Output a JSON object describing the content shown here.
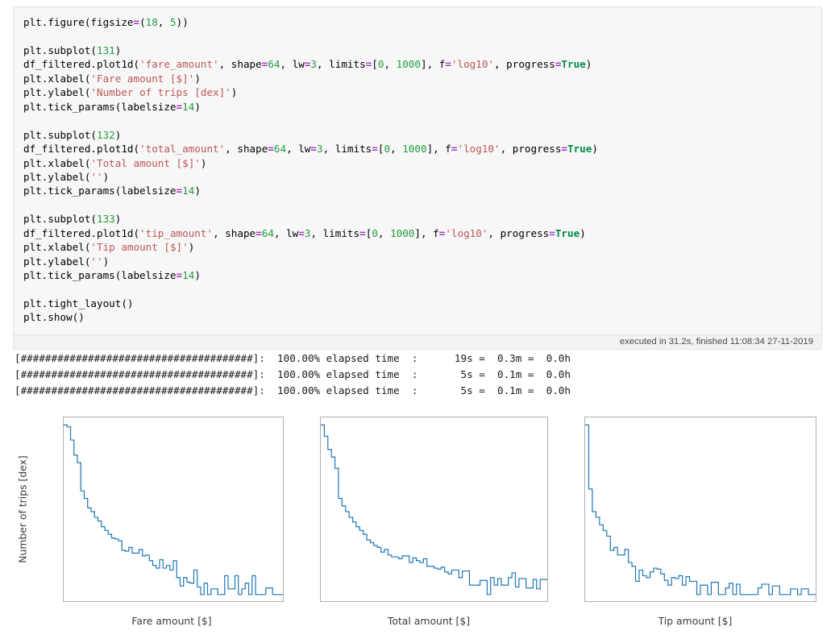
{
  "notebook": {
    "code_lines": [
      [
        {
          "t": "plt.figure(figsize",
          "c": "plain"
        },
        {
          "t": "=",
          "c": "op"
        },
        {
          "t": "(",
          "c": "plain"
        },
        {
          "t": "18",
          "c": "num"
        },
        {
          "t": ", ",
          "c": "plain"
        },
        {
          "t": "5",
          "c": "num"
        },
        {
          "t": "))",
          "c": "plain"
        }
      ],
      [],
      [
        {
          "t": "plt.subplot(",
          "c": "plain"
        },
        {
          "t": "131",
          "c": "num"
        },
        {
          "t": ")",
          "c": "plain"
        }
      ],
      [
        {
          "t": "df_filtered.plot1d(",
          "c": "plain"
        },
        {
          "t": "'fare_amount'",
          "c": "str"
        },
        {
          "t": ", shape",
          "c": "plain"
        },
        {
          "t": "=",
          "c": "op"
        },
        {
          "t": "64",
          "c": "num"
        },
        {
          "t": ", lw",
          "c": "plain"
        },
        {
          "t": "=",
          "c": "op"
        },
        {
          "t": "3",
          "c": "num"
        },
        {
          "t": ", limits",
          "c": "plain"
        },
        {
          "t": "=",
          "c": "op"
        },
        {
          "t": "[",
          "c": "plain"
        },
        {
          "t": "0",
          "c": "num"
        },
        {
          "t": ", ",
          "c": "plain"
        },
        {
          "t": "1000",
          "c": "num"
        },
        {
          "t": "], f",
          "c": "plain"
        },
        {
          "t": "=",
          "c": "op"
        },
        {
          "t": "'log10'",
          "c": "str"
        },
        {
          "t": ", progress",
          "c": "plain"
        },
        {
          "t": "=",
          "c": "op"
        },
        {
          "t": "True",
          "c": "kw"
        },
        {
          "t": ")",
          "c": "plain"
        }
      ],
      [
        {
          "t": "plt.xlabel(",
          "c": "plain"
        },
        {
          "t": "'Fare amount [$]'",
          "c": "str"
        },
        {
          "t": ")",
          "c": "plain"
        }
      ],
      [
        {
          "t": "plt.ylabel(",
          "c": "plain"
        },
        {
          "t": "'Number of trips [dex]'",
          "c": "str"
        },
        {
          "t": ")",
          "c": "plain"
        }
      ],
      [
        {
          "t": "plt.tick_params(labelsize",
          "c": "plain"
        },
        {
          "t": "=",
          "c": "op"
        },
        {
          "t": "14",
          "c": "num"
        },
        {
          "t": ")",
          "c": "plain"
        }
      ],
      [],
      [
        {
          "t": "plt.subplot(",
          "c": "plain"
        },
        {
          "t": "132",
          "c": "num"
        },
        {
          "t": ")",
          "c": "plain"
        }
      ],
      [
        {
          "t": "df_filtered.plot1d(",
          "c": "plain"
        },
        {
          "t": "'total_amount'",
          "c": "str"
        },
        {
          "t": ", shape",
          "c": "plain"
        },
        {
          "t": "=",
          "c": "op"
        },
        {
          "t": "64",
          "c": "num"
        },
        {
          "t": ", lw",
          "c": "plain"
        },
        {
          "t": "=",
          "c": "op"
        },
        {
          "t": "3",
          "c": "num"
        },
        {
          "t": ", limits",
          "c": "plain"
        },
        {
          "t": "=",
          "c": "op"
        },
        {
          "t": "[",
          "c": "plain"
        },
        {
          "t": "0",
          "c": "num"
        },
        {
          "t": ", ",
          "c": "plain"
        },
        {
          "t": "1000",
          "c": "num"
        },
        {
          "t": "], f",
          "c": "plain"
        },
        {
          "t": "=",
          "c": "op"
        },
        {
          "t": "'log10'",
          "c": "str"
        },
        {
          "t": ", progress",
          "c": "plain"
        },
        {
          "t": "=",
          "c": "op"
        },
        {
          "t": "True",
          "c": "kw"
        },
        {
          "t": ")",
          "c": "plain"
        }
      ],
      [
        {
          "t": "plt.xlabel(",
          "c": "plain"
        },
        {
          "t": "'Total amount [$]'",
          "c": "str"
        },
        {
          "t": ")",
          "c": "plain"
        }
      ],
      [
        {
          "t": "plt.ylabel(",
          "c": "plain"
        },
        {
          "t": "''",
          "c": "str"
        },
        {
          "t": ")",
          "c": "plain"
        }
      ],
      [
        {
          "t": "plt.tick_params(labelsize",
          "c": "plain"
        },
        {
          "t": "=",
          "c": "op"
        },
        {
          "t": "14",
          "c": "num"
        },
        {
          "t": ")",
          "c": "plain"
        }
      ],
      [],
      [
        {
          "t": "plt.subplot(",
          "c": "plain"
        },
        {
          "t": "133",
          "c": "num"
        },
        {
          "t": ")",
          "c": "plain"
        }
      ],
      [
        {
          "t": "df_filtered.plot1d(",
          "c": "plain"
        },
        {
          "t": "'tip_amount'",
          "c": "str"
        },
        {
          "t": ", shape",
          "c": "plain"
        },
        {
          "t": "=",
          "c": "op"
        },
        {
          "t": "64",
          "c": "num"
        },
        {
          "t": ", lw",
          "c": "plain"
        },
        {
          "t": "=",
          "c": "op"
        },
        {
          "t": "3",
          "c": "num"
        },
        {
          "t": ", limits",
          "c": "plain"
        },
        {
          "t": "=",
          "c": "op"
        },
        {
          "t": "[",
          "c": "plain"
        },
        {
          "t": "0",
          "c": "num"
        },
        {
          "t": ", ",
          "c": "plain"
        },
        {
          "t": "1000",
          "c": "num"
        },
        {
          "t": "], f",
          "c": "plain"
        },
        {
          "t": "=",
          "c": "op"
        },
        {
          "t": "'log10'",
          "c": "str"
        },
        {
          "t": ", progress",
          "c": "plain"
        },
        {
          "t": "=",
          "c": "op"
        },
        {
          "t": "True",
          "c": "kw"
        },
        {
          "t": ")",
          "c": "plain"
        }
      ],
      [
        {
          "t": "plt.xlabel(",
          "c": "plain"
        },
        {
          "t": "'Tip amount [$]'",
          "c": "str"
        },
        {
          "t": ")",
          "c": "plain"
        }
      ],
      [
        {
          "t": "plt.ylabel(",
          "c": "plain"
        },
        {
          "t": "''",
          "c": "str"
        },
        {
          "t": ")",
          "c": "plain"
        }
      ],
      [
        {
          "t": "plt.tick_params(labelsize",
          "c": "plain"
        },
        {
          "t": "=",
          "c": "op"
        },
        {
          "t": "14",
          "c": "num"
        },
        {
          "t": ")",
          "c": "plain"
        }
      ],
      [],
      [
        {
          "t": "plt.tight_layout()",
          "c": "plain"
        }
      ],
      [
        {
          "t": "plt.show()",
          "c": "plain"
        }
      ]
    ],
    "execution_info": "executed in 31.2s, finished 11:08:34 27-11-2019",
    "stdout_lines": [
      "[######################################]:  100.00% elapsed time  :      19s =  0.3m =  0.0h",
      "[######################################]:  100.00% elapsed time  :       5s =  0.1m =  0.0h",
      "[######################################]:  100.00% elapsed time  :       5s =  0.1m =  0.0h"
    ]
  },
  "colors": {
    "line": "#1f77b4",
    "cell_background": "#f7f7f7",
    "string": "#bc5757",
    "number": "#1f9e3e",
    "operator": "#a935c8",
    "keyword": "#008a46"
  },
  "chart_data": [
    {
      "type": "line",
      "style": "step",
      "title": "",
      "xlabel": "Fare amount [$]",
      "ylabel": "Number of trips [dex]",
      "xlim": [
        0,
        1000
      ],
      "ylim": [
        -0.35,
        9.4
      ],
      "xticks": [
        0,
        200,
        400,
        600,
        800,
        1000
      ],
      "yticks": [
        0,
        2,
        4,
        6,
        8
      ],
      "grid": false,
      "legend": "none",
      "bins": 64,
      "bin_width": 15.625,
      "x": [
        7.8,
        23.4,
        39.1,
        54.7,
        70.3,
        85.9,
        101.6,
        117.2,
        132.8,
        148.4,
        164.1,
        179.7,
        195.3,
        210.9,
        226.6,
        242.2,
        257.8,
        273.4,
        289.1,
        304.7,
        320.3,
        335.9,
        351.6,
        367.2,
        382.8,
        398.4,
        414.1,
        429.7,
        445.3,
        460.9,
        476.6,
        492.2,
        507.8,
        523.4,
        539.1,
        554.7,
        570.3,
        585.9,
        601.6,
        617.2,
        632.8,
        648.4,
        664.1,
        679.7,
        695.3,
        710.9,
        726.6,
        742.2,
        757.8,
        773.4,
        789.1,
        804.7,
        820.3,
        835.9,
        851.6,
        867.2,
        882.8,
        898.4,
        914.1,
        929.7,
        945.3,
        960.9,
        976.6,
        992.2
      ],
      "y": [
        9.0,
        8.9,
        8.2,
        7.4,
        7.0,
        5.5,
        5.1,
        4.6,
        4.4,
        4.1,
        3.9,
        3.6,
        3.4,
        3.2,
        3.0,
        2.95,
        2.85,
        2.35,
        2.3,
        2.5,
        2.2,
        2.2,
        2.4,
        2.05,
        2.1,
        1.8,
        1.55,
        1.4,
        1.85,
        1.4,
        1.55,
        1.3,
        1.8,
        0.9,
        0.45,
        0.9,
        0.65,
        0.6,
        1.3,
        0.4,
        0.0,
        0.6,
        0.0,
        0.3,
        0.3,
        0.0,
        0.0,
        1.0,
        0.3,
        0.3,
        1.0,
        0.0,
        0.3,
        0.6,
        0.0,
        1.0,
        0.0,
        0.0,
        0.0,
        0.35,
        0.35,
        0.0,
        0.0,
        0.0
      ]
    },
    {
      "type": "line",
      "style": "step",
      "title": "",
      "xlabel": "Total amount [$]",
      "ylabel": "",
      "xlim": [
        0,
        1000
      ],
      "ylim": [
        -0.35,
        9.4
      ],
      "xticks": [
        0,
        200,
        400,
        600,
        800,
        1000
      ],
      "yticks": [
        0,
        2,
        4,
        6,
        8
      ],
      "grid": false,
      "legend": "none",
      "bins": 64,
      "bin_width": 15.625,
      "x": [
        7.8,
        23.4,
        39.1,
        54.7,
        70.3,
        85.9,
        101.6,
        117.2,
        132.8,
        148.4,
        164.1,
        179.7,
        195.3,
        210.9,
        226.6,
        242.2,
        257.8,
        273.4,
        289.1,
        304.7,
        320.3,
        335.9,
        351.6,
        367.2,
        382.8,
        398.4,
        414.1,
        429.7,
        445.3,
        460.9,
        476.6,
        492.2,
        507.8,
        523.4,
        539.1,
        554.7,
        570.3,
        585.9,
        601.6,
        617.2,
        632.8,
        648.4,
        664.1,
        679.7,
        695.3,
        710.9,
        726.6,
        742.2,
        757.8,
        773.4,
        789.1,
        804.7,
        820.3,
        835.9,
        851.6,
        867.2,
        882.8,
        898.4,
        914.1,
        929.7,
        945.3,
        960.9,
        976.6,
        992.2
      ],
      "y": [
        9.0,
        8.4,
        7.7,
        7.3,
        6.7,
        5.1,
        4.7,
        4.4,
        4.1,
        3.85,
        3.6,
        3.4,
        3.2,
        2.9,
        2.75,
        2.6,
        2.5,
        2.25,
        2.4,
        2.1,
        2.0,
        2.0,
        1.9,
        2.05,
        2.05,
        1.7,
        1.95,
        1.8,
        1.7,
        1.9,
        1.5,
        1.5,
        1.4,
        1.35,
        1.45,
        1.2,
        1.1,
        1.3,
        1.3,
        0.9,
        1.25,
        1.25,
        0.5,
        0.5,
        0.5,
        0.75,
        0.75,
        0.0,
        0.9,
        0.5,
        0.85,
        0.5,
        0.5,
        0.9,
        1.15,
        0.4,
        0.85,
        0.85,
        0.35,
        0.35,
        0.8,
        0.3,
        0.8,
        0.8
      ]
    },
    {
      "type": "line",
      "style": "step",
      "title": "",
      "xlabel": "Tip amount [$]",
      "ylabel": "",
      "xlim": [
        0,
        1000
      ],
      "ylim": [
        -0.35,
        9.4
      ],
      "xticks": [
        0,
        200,
        400,
        600,
        800,
        1000
      ],
      "yticks": [
        0,
        2,
        4,
        6,
        8
      ],
      "grid": false,
      "legend": "none",
      "bins": 64,
      "bin_width": 15.625,
      "x": [
        7.8,
        23.4,
        39.1,
        54.7,
        70.3,
        85.9,
        101.6,
        117.2,
        132.8,
        148.4,
        164.1,
        179.7,
        195.3,
        210.9,
        226.6,
        242.2,
        257.8,
        273.4,
        289.1,
        304.7,
        320.3,
        335.9,
        351.6,
        367.2,
        382.8,
        398.4,
        414.1,
        429.7,
        445.3,
        460.9,
        476.6,
        492.2,
        507.8,
        523.4,
        539.1,
        554.7,
        570.3,
        585.9,
        601.6,
        617.2,
        632.8,
        648.4,
        664.1,
        679.7,
        695.3,
        710.9,
        726.6,
        742.2,
        757.8,
        773.4,
        789.1,
        804.7,
        820.3,
        835.9,
        851.6,
        867.2,
        882.8,
        898.4,
        914.1,
        929.7,
        945.3,
        960.9,
        976.6,
        992.2
      ],
      "y": [
        9.0,
        5.6,
        4.4,
        4.1,
        3.7,
        3.4,
        3.1,
        2.35,
        2.5,
        2.1,
        2.1,
        2.4,
        1.7,
        1.5,
        0.7,
        1.3,
        1.0,
        0.9,
        1.2,
        1.4,
        1.35,
        1.1,
        0.75,
        0.5,
        0.9,
        0.85,
        1.0,
        0.5,
        0.95,
        0.7,
        0.7,
        0.0,
        0.5,
        0.5,
        0.0,
        0.65,
        0.65,
        0.0,
        0.0,
        0.35,
        0.6,
        0.0,
        0.55,
        0.0,
        0.0,
        0.0,
        0.0,
        0.0,
        0.35,
        0.55,
        0.55,
        0.0,
        0.45,
        0.45,
        0.0,
        0.0,
        0.0,
        0.3,
        0.3,
        0.0,
        0.3,
        0.3,
        0.0,
        0.0
      ]
    }
  ]
}
